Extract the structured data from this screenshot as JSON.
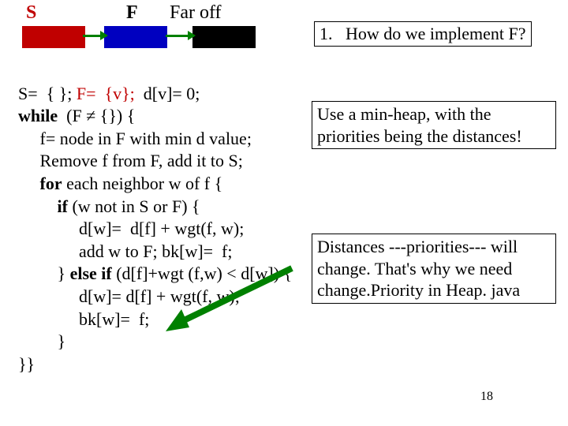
{
  "legend": {
    "S": "S",
    "F": "F",
    "Far": "Far off"
  },
  "question": "1.   How do we implement F?",
  "algo": {
    "l1a": "S=  { }; ",
    "l1b": "F=  {v};",
    "l1c": "  d[v]= 0;",
    "l2a": "while",
    "l2b": "  (F ≠ {}) {",
    "l3": "     f= node in F with min d value;",
    "l4": "     Remove f from F, add it to S;",
    "l5a": "     for",
    "l5b": " each neighbor w of f {",
    "l6a": "         if",
    "l6b": " (w not in S or F) {",
    "l7": "              d[w]=  d[f] + wgt(f, w);",
    "l8": "              add w to F; bk[w]=  f;",
    "l9a": "         } ",
    "l9b": "else if",
    "l9c": " (d[f]+wgt (f,w) < d[w]) {",
    "l10": "              d[w]= d[f] + wgt(f, w);",
    "l11": "              bk[w]=  f;",
    "l12": "         }",
    "l13": "}}"
  },
  "answer": "Use a min-heap, with the priorities being the distances!",
  "note": "Distances ---priorities--- will change. That's why we need change.Priority in Heap. java",
  "page": "18"
}
